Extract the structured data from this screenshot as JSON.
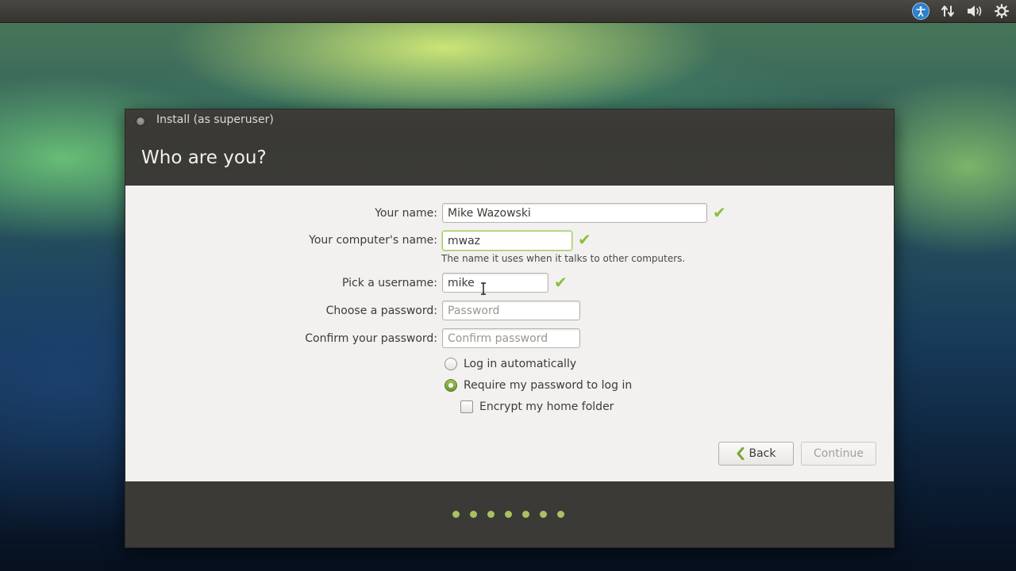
{
  "topbar": {
    "icons": [
      "accessibility-icon",
      "network-icon",
      "volume-icon",
      "settings-gear-icon"
    ]
  },
  "window": {
    "title": "Install (as superuser)",
    "heading": "Who are you?"
  },
  "form": {
    "name_label": "Your name:",
    "name_value": "Mike Wazowski",
    "computer_label": "Your computer's name:",
    "computer_value": "mwaz",
    "computer_hint": "The name it uses when it talks to other computers.",
    "username_label": "Pick a username:",
    "username_value": "mike",
    "password_label": "Choose a password:",
    "password_placeholder": "Password",
    "confirm_label": "Confirm your password:",
    "confirm_placeholder": "Confirm password",
    "login_auto": "Log in automatically",
    "login_password": "Require my password to log in",
    "encrypt_home": "Encrypt my home folder"
  },
  "buttons": {
    "back": "Back",
    "continue": "Continue"
  },
  "progress": {
    "step_count": 7
  },
  "colors": {
    "accent_green": "#8cbd3e",
    "titlebar": "#3b3a36"
  }
}
